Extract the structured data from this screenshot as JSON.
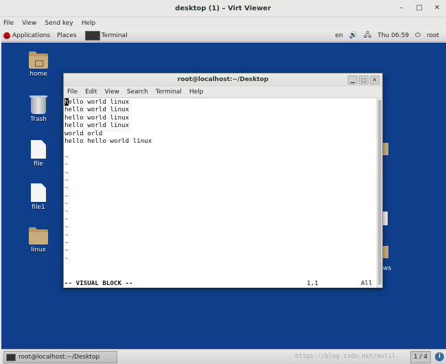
{
  "viewer": {
    "title": "desktop (1) – Virt Viewer",
    "controls": [
      "–",
      "□",
      "✕"
    ],
    "menu": [
      "File",
      "View",
      "Send key",
      "Help"
    ]
  },
  "panel": {
    "applications": "Applications",
    "places": "Places",
    "task": "Terminal",
    "lang": "en",
    "clock": "Thu 06:59",
    "user": "root"
  },
  "desktop": {
    "icons": [
      "home",
      "Trash",
      "file",
      "file1",
      "linux"
    ],
    "edge_label": "ws"
  },
  "terminal": {
    "title": "root@localhost:~/Desktop",
    "menu": [
      "File",
      "Edit",
      "View",
      "Search",
      "Terminal",
      "Help"
    ],
    "cursor_char": "h",
    "first_line_rest": "ello world linux",
    "lines": [
      "hello world linux",
      "hello world linux",
      "hello world linux",
      "world orld",
      "hello hello world linux"
    ],
    "tilde": "~",
    "status_mode": "-- VISUAL BLOCK --",
    "status_pos": "1,1",
    "status_all": "All"
  },
  "taskbar": {
    "task": "root@localhost:~/Desktop",
    "watermark": "https://blog.csdn.net/mulil",
    "pager": "1 / 4",
    "info": "i"
  },
  "colors": {
    "desktop_bg": "#0f3e8a",
    "tilde": "#3e53ff"
  }
}
